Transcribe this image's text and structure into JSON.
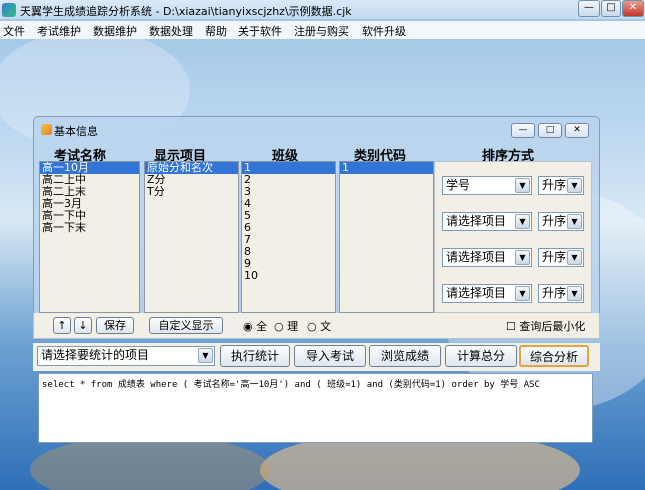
{
  "window": {
    "title": "天翼学生成绩追踪分析系统 - D:\\xiazai\\tianyixscjzhz\\示例数据.cjk"
  },
  "menu": [
    "文件",
    "考试维护",
    "数据维护",
    "数据处理",
    "帮助",
    "关于软件",
    "注册与购买",
    "软件升级"
  ],
  "dialog": {
    "title": "基本信息",
    "headers": {
      "exam": "考试名称",
      "display": "显示项目",
      "class": "班级",
      "category": "类别代码",
      "sort": "排序方式"
    },
    "exam_names": [
      "高一10月",
      "高二上中",
      "高二上末",
      "高一3月",
      "高一下中",
      "高一下末"
    ],
    "display_items": [
      "原始分和名次",
      "Z分",
      "T分"
    ],
    "classes": [
      "1",
      "2",
      "3",
      "4",
      "5",
      "6",
      "7",
      "8",
      "9",
      "10"
    ],
    "categories": [
      "1"
    ],
    "sort": [
      {
        "field": "学号",
        "order": "升序"
      },
      {
        "field": "请选择项目",
        "order": "升序"
      },
      {
        "field": "请选择项目",
        "order": "升序"
      },
      {
        "field": "请选择项目",
        "order": "升序"
      }
    ],
    "buttons": {
      "up": "↑",
      "down": "↓",
      "save": "保存",
      "custom": "自定义显示"
    },
    "radios": [
      "全",
      "理",
      "文"
    ],
    "checkbox_label": "查询后最小化"
  },
  "actions": {
    "stat_select": "请选择要统计的项目",
    "run": "执行统计",
    "import": "导入考试",
    "browse": "浏览成绩",
    "total": "计算总分",
    "analyze": "综合分析"
  },
  "sql": "select * from 成绩表 where  ( 考试名称='高一10月') and ( 班级=1) and (类别代码=1) order by 学号 ASC"
}
